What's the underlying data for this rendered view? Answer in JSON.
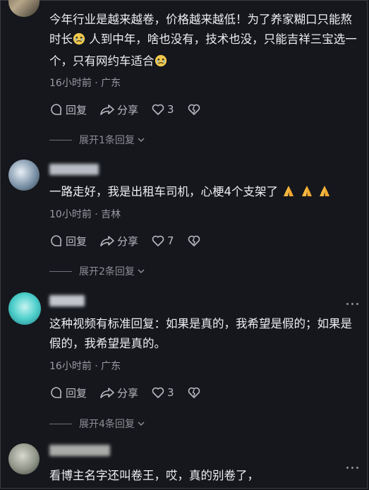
{
  "comments": [
    {
      "text": "今年行业是越来越卷，价格越来越低！为了养家糊口只能熬时长",
      "text2": " 人到中年，啥也没有，技术也没，只能吉祥三宝选一个，只有网约车适合",
      "meta": "16小时前 · 广东",
      "reply_label": "回复",
      "share_label": "分享",
      "like_count": "3",
      "expand": "展开1条回复"
    },
    {
      "text": "一路走好，我是出租车司机，心梗4个支架了",
      "meta": "10小时前 · 吉林",
      "reply_label": "回复",
      "share_label": "分享",
      "like_count": "7",
      "expand": "展开2条回复"
    },
    {
      "text": "这种视频有标准回复：如果是真的，我希望是假的；如果是假的，我希望是真的。",
      "meta": "16小时前 · 广东",
      "reply_label": "回复",
      "share_label": "分享",
      "like_count": "3",
      "expand": "展开4条回复"
    },
    {
      "text": "看博主名字还叫卷王，哎，真的别卷了，"
    }
  ],
  "icons": {
    "reply": "comment-bubble-icon",
    "share": "share-arrow-icon",
    "like": "heart-icon",
    "dislike": "broken-heart-icon",
    "more": "more-dots-icon",
    "chevron": "chevron-down-icon"
  },
  "colors": {
    "background": "#15171c",
    "text": "#eceef2",
    "meta": "#9a9ca3"
  }
}
